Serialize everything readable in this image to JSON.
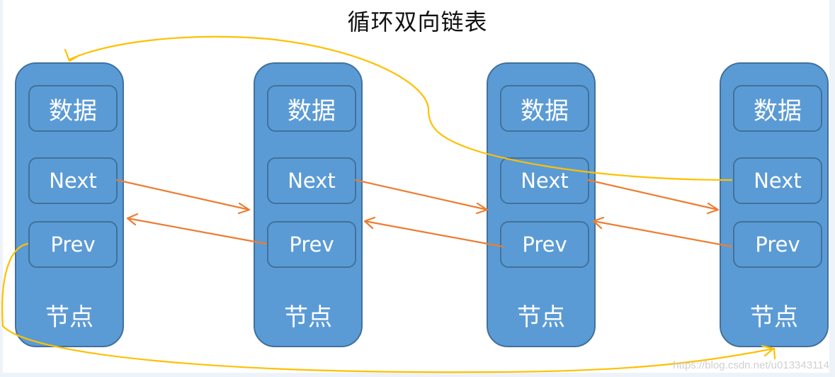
{
  "title": "循环双向链表",
  "nodes": [
    {
      "data_label": "数据",
      "next_label": "Next",
      "prev_label": "Prev",
      "node_label": "节点"
    },
    {
      "data_label": "数据",
      "next_label": "Next",
      "prev_label": "Prev",
      "node_label": "节点"
    },
    {
      "data_label": "数据",
      "next_label": "Next",
      "prev_label": "Prev",
      "node_label": "节点"
    },
    {
      "data_label": "数据",
      "next_label": "Next",
      "prev_label": "Prev",
      "node_label": "节点"
    }
  ],
  "links": {
    "next_prev_color": "#ed7d31",
    "circular_color": "#ffc000"
  },
  "watermark": "https://blog.csdn.net/u013343114"
}
